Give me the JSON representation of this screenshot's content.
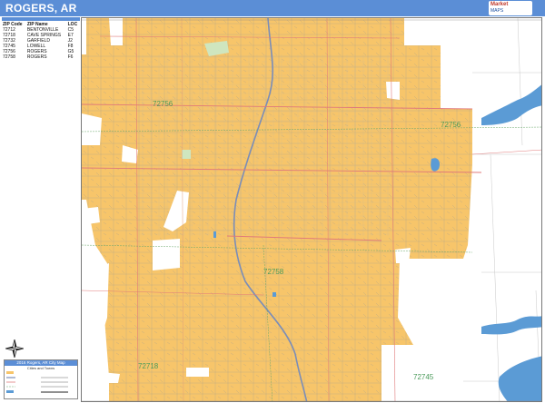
{
  "header": {
    "title": "ROGERS, AR",
    "accent": "#5b8ed6"
  },
  "logo": {
    "line1": "Market",
    "line2": "MAPS"
  },
  "ziptable": {
    "columns": [
      "ZIP Code",
      "ZIP Name",
      "LOC"
    ],
    "rows": [
      [
        "72712",
        "BENTONVILLE",
        "C5"
      ],
      [
        "72718",
        "CAVE SPRINGS",
        "E7"
      ],
      [
        "72732",
        "GARFIELD",
        "J2"
      ],
      [
        "72745",
        "LOWELL",
        "F8"
      ],
      [
        "72756",
        "ROGERS",
        "G5"
      ],
      [
        "72758",
        "ROGERS",
        "F6"
      ]
    ]
  },
  "map": {
    "city_fill": "#f7c56a",
    "water_color": "#5b9bd5",
    "zip_labels": [
      "72756",
      "72756",
      "72758",
      "72718",
      "72745"
    ]
  },
  "legend": {
    "title": "2016 Rogers, AR City Map",
    "subtitle": "Cities and Towns"
  }
}
